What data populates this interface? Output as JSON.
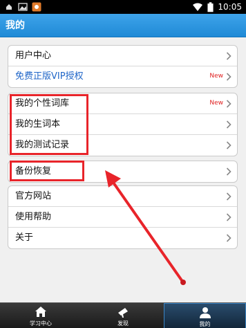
{
  "status_bar": {
    "time": "10:05",
    "icons": [
      "notification-icon",
      "image-icon",
      "app-icon",
      "wifi-icon",
      "battery-icon"
    ]
  },
  "header": {
    "title": "我的"
  },
  "groups": [
    {
      "rows": [
        {
          "label": "用户中心",
          "badge": ""
        },
        {
          "label": "免费正版VIP授权",
          "badge": "New"
        }
      ]
    },
    {
      "rows": [
        {
          "label": "我的个性词库",
          "badge": "New"
        },
        {
          "label": "我的生词本",
          "badge": ""
        },
        {
          "label": "我的测试记录",
          "badge": ""
        }
      ]
    },
    {
      "rows": [
        {
          "label": "备份恢复",
          "badge": ""
        }
      ]
    },
    {
      "rows": [
        {
          "label": "官方网站",
          "badge": ""
        },
        {
          "label": "使用帮助",
          "badge": ""
        },
        {
          "label": "关于",
          "badge": ""
        }
      ]
    }
  ],
  "bottom_nav": [
    {
      "label": "学习中心",
      "icon": "home-icon",
      "active": false
    },
    {
      "label": "发现",
      "icon": "discover-icon",
      "active": false
    },
    {
      "label": "我的",
      "icon": "user-icon",
      "active": true
    }
  ],
  "colors": {
    "accent": "#1f8ad6",
    "link": "#2066c8",
    "new_badge": "#e02020",
    "annotation": "#e8242a"
  }
}
